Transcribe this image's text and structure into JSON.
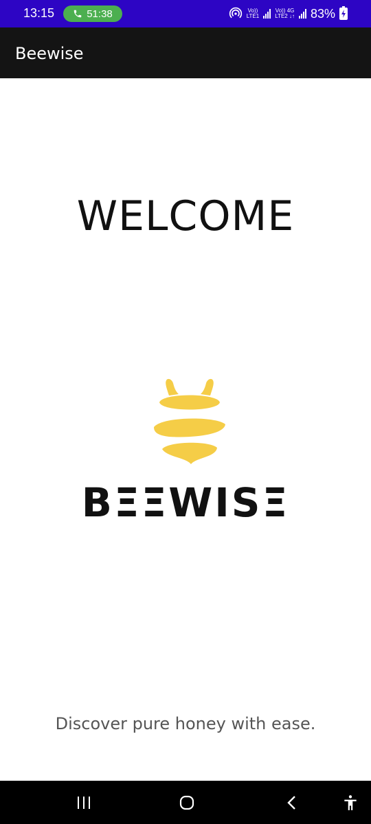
{
  "status_bar": {
    "time": "13:15",
    "call_duration": "51:38",
    "sim1_top": "Vo))",
    "sim1_bottom": "LTE1",
    "sim2_top": "Vo)) 4G",
    "sim2_bottom": "LTE2 ↓↑",
    "battery": "83%",
    "icons": [
      "phone-icon",
      "hotspot-icon",
      "signal-icon",
      "battery-icon"
    ]
  },
  "app_bar": {
    "title": "Beewise"
  },
  "main": {
    "welcome": "WELCOME",
    "brand": "BΞΞWISΞ",
    "tagline": "Discover pure honey with ease.",
    "logo_color": "#f5cd47"
  },
  "nav_bar": {
    "icons": [
      "recent-apps-icon",
      "home-icon",
      "back-icon",
      "accessibility-icon"
    ]
  }
}
